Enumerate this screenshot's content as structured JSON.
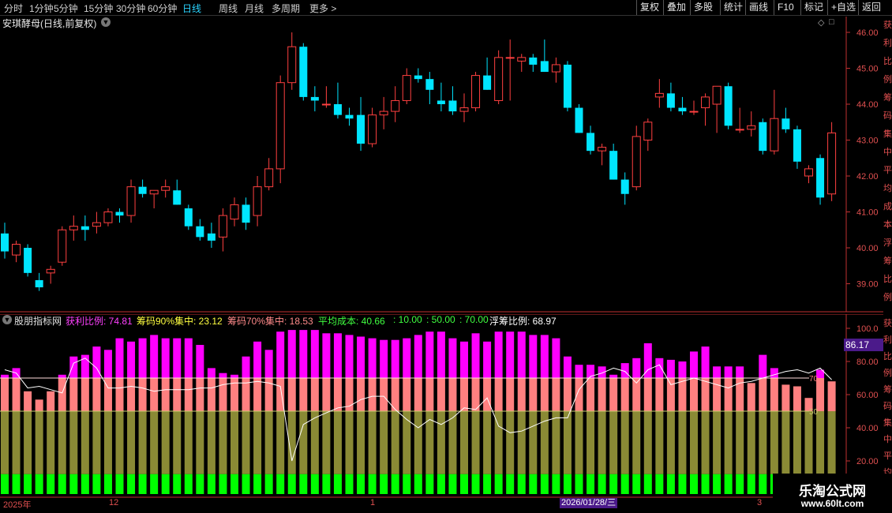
{
  "toolbar": {
    "periods": [
      "分时",
      "1分钟",
      "5分钟",
      "15分钟",
      "30分钟",
      "60分钟",
      "日线",
      "周线",
      "月线",
      "多周期",
      "更多"
    ],
    "active_period": "日线",
    "right_buttons": [
      "复权",
      "叠加",
      "多股",
      "统计",
      "画线",
      "F10",
      "标记",
      "+自选",
      "返回"
    ]
  },
  "main_chart": {
    "title": "安琪酵母(日线,前复权)",
    "price_ticks": [
      "46.00",
      "45.00",
      "44.00",
      "43.00",
      "42.00",
      "41.00",
      "40.00",
      "39.00"
    ]
  },
  "indicator": {
    "name": "股朋指标网",
    "items": [
      {
        "label": "获利比例:",
        "value": "74.81",
        "color": "#ff40ff"
      },
      {
        "label": "筹码90%集中:",
        "value": "23.12",
        "color": "#ffff40"
      },
      {
        "label": "筹码70%集中:",
        "value": "18.53",
        "color": "#ff8a8a"
      },
      {
        "label": "平均成本:",
        "value": "40.66",
        "color": "#40ff40"
      },
      {
        "label": ":",
        "value": "10.00",
        "color": "#40ff40"
      },
      {
        "label": ":",
        "value": "50.00",
        "color": "#40ff40"
      },
      {
        "label": ":",
        "value": "70.00",
        "color": "#40ff40"
      },
      {
        "label": "浮筹比例:",
        "value": "68.97",
        "color": "#ffffff"
      }
    ],
    "y_ticks": [
      "100.0",
      "80.00",
      "60.00",
      "40.00",
      "20.00"
    ],
    "badge": "86.17",
    "line_labels": [
      "70",
      "50"
    ]
  },
  "x_axis": {
    "labels": [
      "2025年",
      "12",
      "1",
      "3"
    ],
    "cursor_date": "2026/01/28/三"
  },
  "watermark": {
    "title": "乐淘公式网",
    "url": "www.60lt.com"
  },
  "side_text": "获利比例筹码集中平均成本浮筹比例",
  "colors": {
    "up": "#ff4040",
    "down": "#00e5ff",
    "magenta": "#ff00ff",
    "salmon": "#ff8080",
    "olive": "#8a8a35",
    "green": "#00ff00"
  },
  "chart_data": {
    "type": "candlestick",
    "candles": [
      [
        40.4,
        40.7,
        39.7,
        39.9
      ],
      [
        39.8,
        40.2,
        39.6,
        40.1
      ],
      [
        40.0,
        40.1,
        39.2,
        39.3
      ],
      [
        39.1,
        39.3,
        38.8,
        38.9
      ],
      [
        39.3,
        39.5,
        39.0,
        39.4
      ],
      [
        39.6,
        40.6,
        39.5,
        40.5
      ],
      [
        40.5,
        40.9,
        40.2,
        40.6
      ],
      [
        40.6,
        40.9,
        40.2,
        40.5
      ],
      [
        40.6,
        41.0,
        40.4,
        40.7
      ],
      [
        40.7,
        41.1,
        40.6,
        41.0
      ],
      [
        41.0,
        41.1,
        40.7,
        40.9
      ],
      [
        40.9,
        41.9,
        40.7,
        41.7
      ],
      [
        41.7,
        41.9,
        41.4,
        41.5
      ],
      [
        41.5,
        41.6,
        41.1,
        41.6
      ],
      [
        41.6,
        41.9,
        41.4,
        41.7
      ],
      [
        41.6,
        41.9,
        41.2,
        41.2
      ],
      [
        41.1,
        41.2,
        40.5,
        40.6
      ],
      [
        40.6,
        40.8,
        40.2,
        40.3
      ],
      [
        40.4,
        40.7,
        40.0,
        40.2
      ],
      [
        40.3,
        41.1,
        39.9,
        40.9
      ],
      [
        40.8,
        41.4,
        40.6,
        41.2
      ],
      [
        41.2,
        41.4,
        40.5,
        40.7
      ],
      [
        40.9,
        42.0,
        40.6,
        41.7
      ],
      [
        41.7,
        42.5,
        41.6,
        42.2
      ],
      [
        42.2,
        44.8,
        41.8,
        44.6
      ],
      [
        44.6,
        46.0,
        44.4,
        45.6
      ],
      [
        45.6,
        45.7,
        44.1,
        44.2
      ],
      [
        44.2,
        44.5,
        43.8,
        44.1
      ],
      [
        44.0,
        44.5,
        43.9,
        44.0
      ],
      [
        44.0,
        44.6,
        43.6,
        43.7
      ],
      [
        43.7,
        43.9,
        43.4,
        43.6
      ],
      [
        43.7,
        44.2,
        42.7,
        42.9
      ],
      [
        42.9,
        43.9,
        42.8,
        43.7
      ],
      [
        43.7,
        44.2,
        43.3,
        43.8
      ],
      [
        43.8,
        44.5,
        43.5,
        44.1
      ],
      [
        44.1,
        45.0,
        44.0,
        44.8
      ],
      [
        44.8,
        45.0,
        44.6,
        44.7
      ],
      [
        44.7,
        44.9,
        44.0,
        44.4
      ],
      [
        44.1,
        44.6,
        43.8,
        44.0
      ],
      [
        44.1,
        44.5,
        43.7,
        43.8
      ],
      [
        43.8,
        44.3,
        43.5,
        43.9
      ],
      [
        43.9,
        44.9,
        43.8,
        44.8
      ],
      [
        44.8,
        45.3,
        44.4,
        44.4
      ],
      [
        44.1,
        45.5,
        44.0,
        45.3
      ],
      [
        45.3,
        45.8,
        44.1,
        45.3
      ],
      [
        45.2,
        45.4,
        44.9,
        45.3
      ],
      [
        45.3,
        45.4,
        44.9,
        45.1
      ],
      [
        45.2,
        45.8,
        44.9,
        44.9
      ],
      [
        44.9,
        45.3,
        44.6,
        45.1
      ],
      [
        45.1,
        45.2,
        43.8,
        43.9
      ],
      [
        43.9,
        44.0,
        43.2,
        43.2
      ],
      [
        43.2,
        43.4,
        42.6,
        42.7
      ],
      [
        42.7,
        42.9,
        42.3,
        42.8
      ],
      [
        42.7,
        42.9,
        41.9,
        41.9
      ],
      [
        41.9,
        42.1,
        41.2,
        41.5
      ],
      [
        41.7,
        43.4,
        41.6,
        43.1
      ],
      [
        43.0,
        43.6,
        42.7,
        43.5
      ],
      [
        44.2,
        44.7,
        43.9,
        44.3
      ],
      [
        44.3,
        44.6,
        43.8,
        43.9
      ],
      [
        43.9,
        44.2,
        43.7,
        43.8
      ],
      [
        43.8,
        44.1,
        43.7,
        43.8
      ],
      [
        43.9,
        44.3,
        43.4,
        44.2
      ],
      [
        44.0,
        44.5,
        43.2,
        44.5
      ],
      [
        44.5,
        44.6,
        43.3,
        43.4
      ],
      [
        43.3,
        43.9,
        43.2,
        43.3
      ],
      [
        43.3,
        43.8,
        43.1,
        43.4
      ],
      [
        43.5,
        43.6,
        42.6,
        42.7
      ],
      [
        42.7,
        44.4,
        42.6,
        43.6
      ],
      [
        43.6,
        43.9,
        43.2,
        43.3
      ],
      [
        43.3,
        43.4,
        42.2,
        42.4
      ],
      [
        42.0,
        42.3,
        41.8,
        42.2
      ],
      [
        42.5,
        42.6,
        41.2,
        41.4
      ],
      [
        41.5,
        43.5,
        41.3,
        43.2
      ]
    ],
    "profit_ratio": [
      72,
      76,
      62,
      57,
      62,
      72,
      83,
      84,
      89,
      87,
      94,
      92,
      94,
      96,
      94,
      94,
      94,
      90,
      76,
      73,
      72,
      83,
      92,
      87,
      98,
      99,
      99,
      99,
      97,
      97,
      96,
      95,
      94,
      93,
      93,
      94,
      96,
      98,
      98,
      94,
      92,
      97,
      92,
      98,
      98,
      98,
      96,
      96,
      94,
      83,
      78,
      78,
      77,
      72,
      79,
      82,
      91,
      82,
      81,
      80,
      86,
      89,
      77,
      77,
      77,
      67,
      84,
      76,
      66,
      65,
      58,
      75,
      68
    ],
    "float_ratio": [
      75,
      73,
      64,
      65,
      63,
      61,
      79,
      82,
      76,
      64,
      64,
      65,
      64,
      62,
      63,
      63,
      63,
      64,
      64,
      66,
      67,
      67,
      68,
      67,
      65,
      20,
      42,
      46,
      49,
      52,
      53,
      57,
      59,
      59,
      51,
      45,
      40,
      45,
      42,
      46,
      52,
      51,
      58,
      41,
      37,
      38,
      41,
      44,
      46,
      46,
      63,
      71,
      73,
      76,
      74,
      67,
      75,
      78,
      66,
      68,
      70,
      68,
      66,
      64,
      67,
      68,
      70,
      72,
      74,
      75,
      73,
      76,
      69
    ],
    "ref_lines": [
      70,
      50,
      10
    ],
    "ylim_indicator": [
      0,
      105
    ]
  }
}
